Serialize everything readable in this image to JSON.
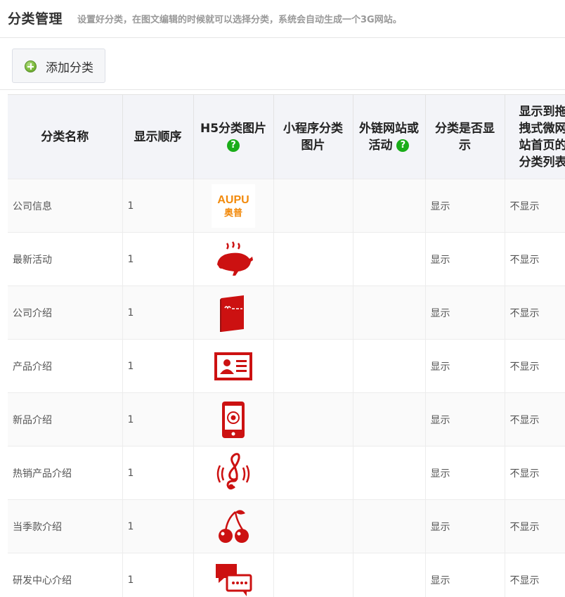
{
  "header": {
    "title": "分类管理",
    "description": "设置好分类，在图文编辑的时候就可以选择分类，系统会自动生成一个3G网站。"
  },
  "toolbar": {
    "add_label": "添加分类"
  },
  "table": {
    "columns": [
      {
        "label": "分类名称"
      },
      {
        "label": "显示顺序"
      },
      {
        "label": "H5分类图片",
        "help_icon": "?"
      },
      {
        "label": "小程序分类图片"
      },
      {
        "label": "外链网站或活动",
        "help_icon": "?"
      },
      {
        "label": "分类是否显示"
      },
      {
        "label": "显示到拖拽式微网站首页的分类列表"
      }
    ],
    "rows": [
      {
        "name": "公司信息",
        "order": "1",
        "icon": "aupu-logo-icon",
        "logo_text_1": "AUPU",
        "logo_text_2": "奥普",
        "visible": "显示",
        "on_home": "不显示"
      },
      {
        "name": "最新活动",
        "order": "1",
        "icon": "roast-chicken-icon",
        "visible": "显示",
        "on_home": "不显示"
      },
      {
        "name": "公司介绍",
        "order": "1",
        "icon": "menu-book-icon",
        "visible": "显示",
        "on_home": "不显示"
      },
      {
        "name": "产品介绍",
        "order": "1",
        "icon": "id-card-icon",
        "visible": "显示",
        "on_home": "不显示"
      },
      {
        "name": "新品介绍",
        "order": "1",
        "icon": "mobile-phone-icon",
        "visible": "显示",
        "on_home": "不显示"
      },
      {
        "name": "热销产品介绍",
        "order": "1",
        "icon": "music-note-icon",
        "visible": "显示",
        "on_home": "不显示"
      },
      {
        "name": "当季款介绍",
        "order": "1",
        "icon": "cherry-icon",
        "visible": "显示",
        "on_home": "不显示"
      },
      {
        "name": "研发中心介绍",
        "order": "1",
        "icon": "chat-bubbles-icon",
        "visible": "显示",
        "on_home": "不显示"
      }
    ]
  },
  "colors": {
    "icon_red": "#cc1111",
    "logo_orange": "#f28a0c",
    "help_green": "#1aad19"
  }
}
